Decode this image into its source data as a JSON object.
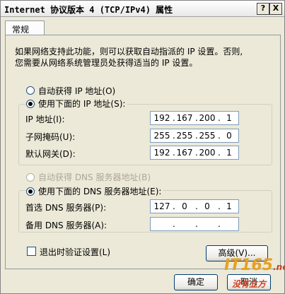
{
  "window": {
    "title": "Internet 协议版本 4 (TCP/IPv4) 属性",
    "help_button": "?",
    "close_button": "X"
  },
  "tabs": [
    {
      "label": "常规"
    }
  ],
  "description": [
    "如果网络支持此功能，则可以获取自动指派的 IP 设置。否则,",
    "您需要从网络系统管理员处获得适当的 IP 设置。"
  ],
  "ip_section": {
    "auto_label": "自动获得 IP 地址(O)",
    "manual_label": "使用下面的 IP 地址(S):",
    "selected": "manual",
    "fields": [
      {
        "label": "IP 地址(I):",
        "octets": [
          "192",
          "167",
          "200",
          "1"
        ]
      },
      {
        "label": "子网掩码(U):",
        "octets": [
          "255",
          "255",
          "255",
          "0"
        ]
      },
      {
        "label": "默认网关(D):",
        "octets": [
          "192",
          "167",
          "200",
          "1"
        ]
      }
    ]
  },
  "dns_section": {
    "auto_label": "自动获得 DNS 服务器地址(B)",
    "manual_label": "使用下面的 DNS 服务器地址(E):",
    "selected": "manual",
    "fields": [
      {
        "label": "首选 DNS 服务器(P):",
        "octets": [
          "127",
          "0",
          "0",
          "1"
        ]
      },
      {
        "label": "备用 DNS 服务器(A):",
        "octets": [
          "",
          "",
          "",
          ""
        ]
      }
    ]
  },
  "validate_label": "退出时验证设置(L)",
  "validate_checked": false,
  "buttons": {
    "advanced": "高级(V)...",
    "ok": "确定",
    "cancel": "取消"
  },
  "watermark": {
    "site": "IT165",
    "domain": ".net",
    "tagline": "没有立方",
    "colors": {
      "primary": "#e8a020",
      "accent": "#d04020"
    }
  }
}
